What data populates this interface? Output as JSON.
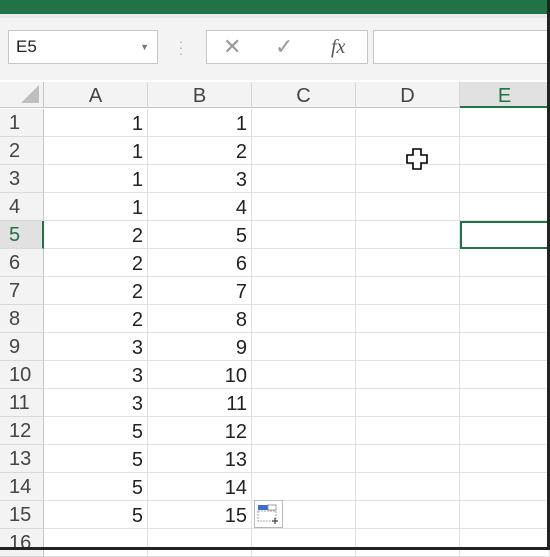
{
  "namebox": {
    "value": "E5"
  },
  "formula": {
    "cancel_icon": "cancel-icon",
    "enter_icon": "enter-icon",
    "fx_label": "fx",
    "content": ""
  },
  "columns": [
    "A",
    "B",
    "C",
    "D",
    "E"
  ],
  "selected_column": "E",
  "rows": [
    "1",
    "2",
    "3",
    "4",
    "5",
    "6",
    "7",
    "8",
    "9",
    "10",
    "11",
    "12",
    "13",
    "14",
    "15",
    "16"
  ],
  "selected_row": "5",
  "cells": [
    {
      "a": "1",
      "b": "1"
    },
    {
      "a": "1",
      "b": "2"
    },
    {
      "a": "1",
      "b": "3"
    },
    {
      "a": "1",
      "b": "4"
    },
    {
      "a": "2",
      "b": "5"
    },
    {
      "a": "2",
      "b": "6"
    },
    {
      "a": "2",
      "b": "7"
    },
    {
      "a": "2",
      "b": "8"
    },
    {
      "a": "3",
      "b": "9"
    },
    {
      "a": "3",
      "b": "10"
    },
    {
      "a": "3",
      "b": "11"
    },
    {
      "a": "5",
      "b": "12"
    },
    {
      "a": "5",
      "b": "13"
    },
    {
      "a": "5",
      "b": "14"
    },
    {
      "a": "5",
      "b": "15"
    },
    {
      "a": "",
      "b": ""
    }
  ],
  "colors": {
    "accent": "#217346",
    "header_bg": "#f3f3f3",
    "selected_header_bg": "#e1e1e1"
  }
}
